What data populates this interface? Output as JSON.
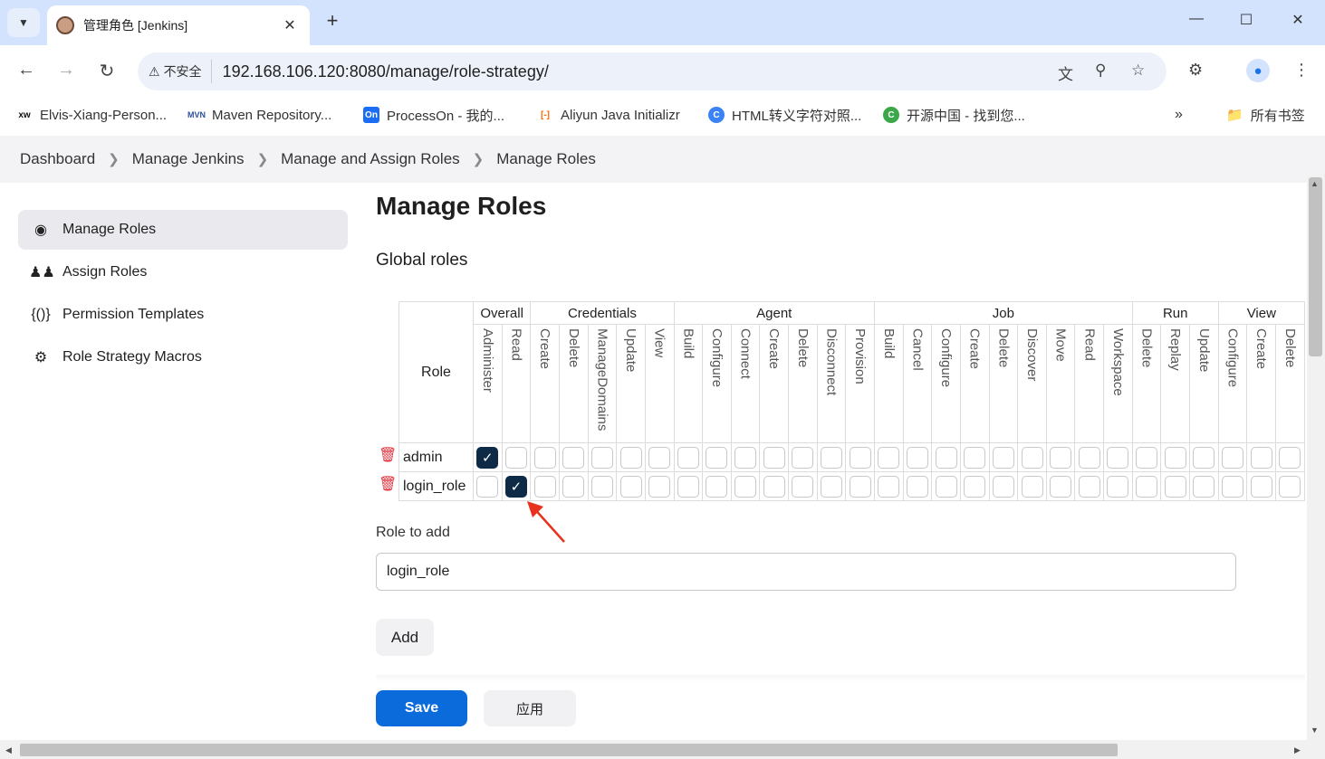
{
  "browser": {
    "tab_title": "管理角色 [Jenkins]",
    "security_label": "不安全",
    "url": "192.168.106.120:8080/manage/role-strategy/",
    "bookmarks": [
      {
        "icon": "xw",
        "label": "Elvis-Xiang-Person..."
      },
      {
        "icon": "MVN",
        "label": "Maven Repository..."
      },
      {
        "icon": "On",
        "label": "ProcessOn - 我的..."
      },
      {
        "icon": "[-]",
        "label": "Aliyun Java Initializr"
      },
      {
        "icon": "C",
        "label": "HTML转义字符对照..."
      },
      {
        "icon": "C",
        "label": "开源中国 - 找到您..."
      }
    ],
    "all_bookmarks": "所有书签"
  },
  "breadcrumb": [
    "Dashboard",
    "Manage Jenkins",
    "Manage and Assign Roles",
    "Manage Roles"
  ],
  "sidebar": {
    "items": [
      {
        "label": "Manage Roles",
        "icon": "fingerprint-icon",
        "active": true
      },
      {
        "label": "Assign Roles",
        "icon": "users-icon",
        "active": false
      },
      {
        "label": "Permission Templates",
        "icon": "braces-icon",
        "active": false
      },
      {
        "label": "Role Strategy Macros",
        "icon": "puzzle-icon",
        "active": false
      }
    ]
  },
  "page": {
    "title": "Manage Roles",
    "section": "Global roles",
    "role_header": "Role",
    "groups": [
      {
        "name": "Overall",
        "span": 2
      },
      {
        "name": "Credentials",
        "span": 5
      },
      {
        "name": "Agent",
        "span": 7
      },
      {
        "name": "Job",
        "span": 9
      },
      {
        "name": "Run",
        "span": 3
      },
      {
        "name": "View",
        "span": 3
      }
    ],
    "permissions": [
      "Administer",
      "Read",
      "Create",
      "Delete",
      "ManageDomains",
      "Update",
      "View",
      "Build",
      "Configure",
      "Connect",
      "Create",
      "Delete",
      "Disconnect",
      "Provision",
      "Build",
      "Cancel",
      "Configure",
      "Create",
      "Delete",
      "Discover",
      "Move",
      "Read",
      "Workspace",
      "Delete",
      "Replay",
      "Update",
      "Configure",
      "Create",
      "Delete"
    ],
    "roles": [
      {
        "name": "admin",
        "checked": [
          0
        ]
      },
      {
        "name": "login_role",
        "checked": [
          1
        ]
      }
    ],
    "role_to_add_label": "Role to add",
    "role_to_add_value": "login_role",
    "add_button": "Add",
    "save_button": "Save",
    "apply_button": "应用"
  },
  "colors": {
    "accent": "#0c6bdb",
    "checked": "#0e2a47",
    "delete": "#e0303a",
    "annotation": "#e8321f"
  }
}
